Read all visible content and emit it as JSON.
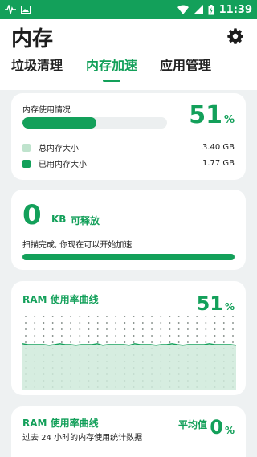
{
  "status_bar": {
    "time": "11:39"
  },
  "header": {
    "title": "内存",
    "tabs": [
      {
        "label": "垃圾清理",
        "active": false
      },
      {
        "label": "内存加速",
        "active": true
      },
      {
        "label": "应用管理",
        "active": false
      }
    ]
  },
  "memory_card": {
    "label": "内存使用情况",
    "percent": "51",
    "percent_unit": "%",
    "usage_fraction": 0.51,
    "total_label": "总内存大小",
    "total_value": "3.40 GB",
    "used_label": "已用内存大小",
    "used_value": "1.77 GB"
  },
  "release_card": {
    "amount": "0",
    "unit": "KB",
    "label": "可释放",
    "scan_text": "扫描完成, 你现在可以开始加速",
    "progress_fraction": 1.0
  },
  "ram_curve_card": {
    "title": "RAM 使用率曲线",
    "percent": "51",
    "percent_unit": "%",
    "level_fraction": 0.51
  },
  "ram_avg_card": {
    "title": "RAM 使用率曲线",
    "subtitle": "过去 24 小时的内存使用统计数据",
    "avg_label": "平均值",
    "avg_value": "0",
    "avg_unit": "%"
  },
  "colors": {
    "accent": "#13a05a",
    "accent_light": "#bfe3cd",
    "bar_track": "#eceff0",
    "background": "#eef1f2"
  }
}
